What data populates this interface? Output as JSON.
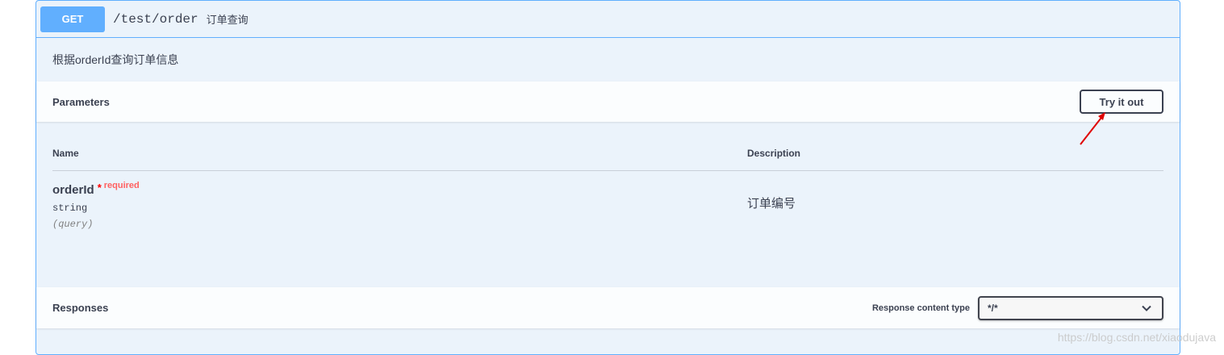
{
  "operation": {
    "method": "GET",
    "path": "/test/order",
    "summary": "订单查询",
    "description": "根据orderId查询订单信息"
  },
  "parameters": {
    "title": "Parameters",
    "try_button": "Try it out",
    "columns": {
      "name": "Name",
      "description": "Description"
    },
    "items": [
      {
        "name": "orderId",
        "required_star": "*",
        "required_label": "required",
        "type": "string",
        "in": "(query)",
        "description": "订单编号"
      }
    ]
  },
  "responses": {
    "title": "Responses",
    "content_type_label": "Response content type",
    "content_type_value": "*/*"
  },
  "colors": {
    "get_method": "#61affe",
    "opblock_bg": "#ebf3fb",
    "annotation_arrow": "#e00000",
    "required": "#ff0000"
  },
  "watermark": "https://blog.csdn.net/xiaodujava"
}
